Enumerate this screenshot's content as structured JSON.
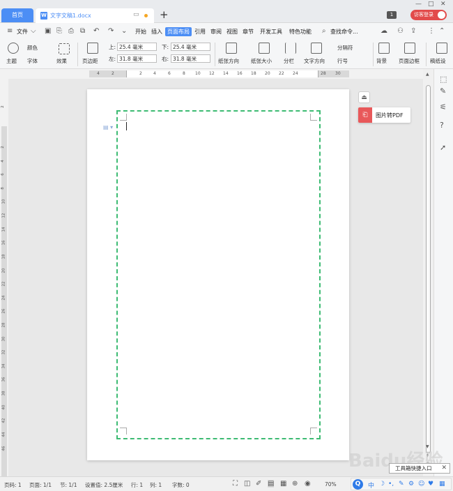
{
  "titlebar": {
    "home_tab": "首页",
    "doc_tab": "文字文稿1.docx",
    "doc_icon": "W",
    "new_tab": "+",
    "window_count": "1",
    "login": "访客登录",
    "minimize": "—",
    "restore": "□",
    "close": "✕"
  },
  "menu": {
    "file": "文件",
    "items": [
      "开始",
      "插入",
      "页面布局",
      "引用",
      "审阅",
      "视图",
      "章节",
      "开发工具",
      "特色功能"
    ],
    "active": "页面布局",
    "search": "查找命令..."
  },
  "ribbon": {
    "theme": "主题",
    "color": "颜色",
    "font": "字体",
    "effect": "效果",
    "margins": "页边距",
    "top_label": "上:",
    "top_value": "25.4 毫米",
    "bottom_label": "下:",
    "bottom_value": "25.4 毫米",
    "left_label": "左:",
    "left_value": "31.8 毫米",
    "right_label": "右:",
    "right_value": "31.8 毫米",
    "orientation": "纸张方向",
    "size": "纸张大小",
    "columns": "分栏",
    "text_direction": "文字方向",
    "breaks": "分隔符",
    "line_numbers": "行号",
    "background": "背景",
    "page_border": "页面边框",
    "manuscript": "稿纸设"
  },
  "ruler": {
    "h_ticks": [
      "4",
      "2",
      "2",
      "4",
      "6",
      "8",
      "10",
      "12",
      "14",
      "16",
      "18",
      "20",
      "22",
      "24",
      "28",
      "30"
    ],
    "v_ticks": [
      "2",
      "2",
      "4",
      "6",
      "8",
      "10",
      "12",
      "14",
      "16",
      "18",
      "20",
      "22",
      "24",
      "26",
      "28",
      "30",
      "32",
      "34",
      "36",
      "38",
      "40",
      "42",
      "44",
      "46"
    ]
  },
  "side": {
    "pdf_button": "图片转PDF"
  },
  "statusbar": {
    "page_num": "页码: 1",
    "pages": "页面: 1/1",
    "section": "节: 1/1",
    "setting": "设置值: 2.5厘米",
    "row": "行: 1",
    "col": "列: 1",
    "words": "字数: 0",
    "zoom": "70%",
    "tooltip": "工具箱快捷入口"
  },
  "ime": {
    "logo": "Q",
    "mode": "中"
  },
  "watermark": "Baidu经验",
  "colors": {
    "accent": "#4c8ef5",
    "frame": "#3dbb73",
    "login": "#e24b4b",
    "pdf": "#e8585a"
  }
}
